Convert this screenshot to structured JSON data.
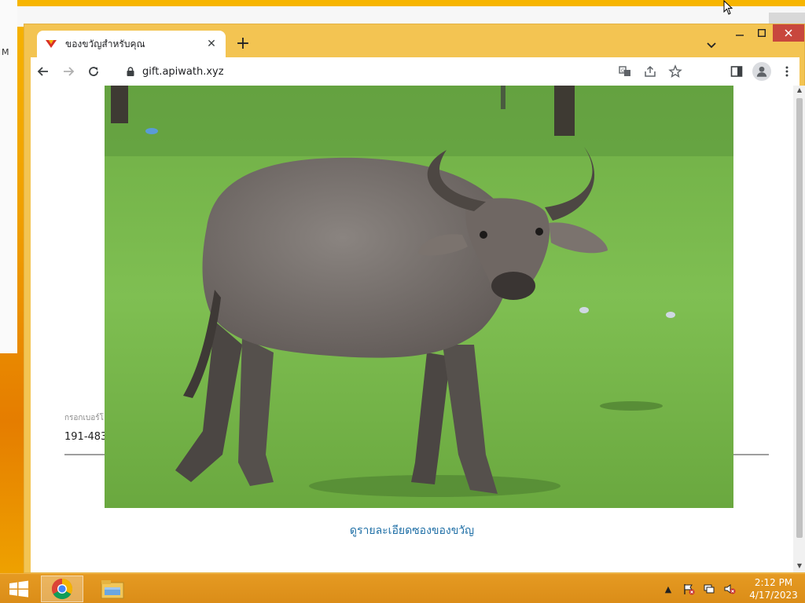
{
  "browser": {
    "tab_title": "ของขวัญสำหรับคุณ",
    "url": "gift.apiwath.xyz"
  },
  "page": {
    "field_label": "กรอกเบอร์โ",
    "field_value": "191-483",
    "photo_alt": "ควาย",
    "details_link": "ดูรายละเอียดซองของขวัญ"
  },
  "background_window": {
    "left_text": "M"
  },
  "taskbar": {
    "time": "2:12 PM",
    "date": "4/17/2023"
  },
  "colors": {
    "chrome_frame": "#f3c452",
    "link": "#1f6fa6",
    "taskbar": "#e59a22",
    "close_button": "#c8473d"
  }
}
